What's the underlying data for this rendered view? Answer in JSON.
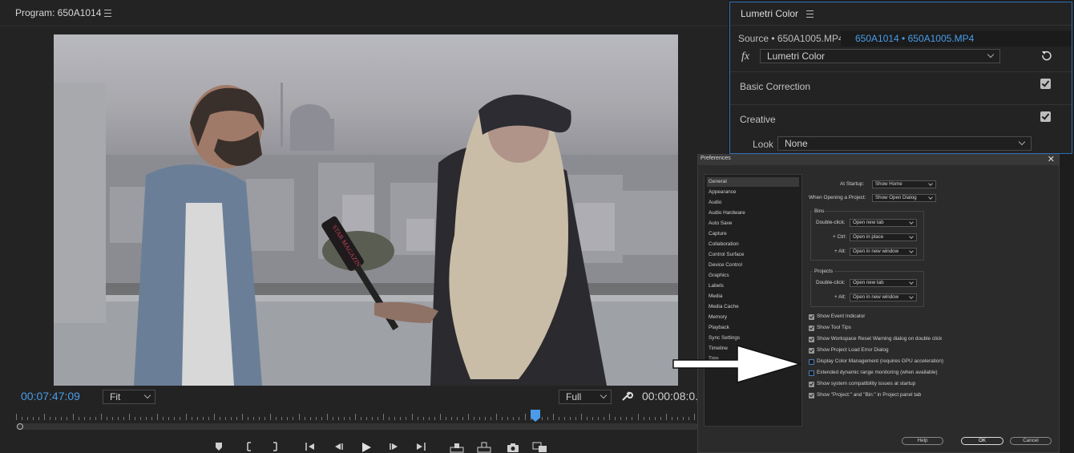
{
  "program": {
    "title": "Program: 650A1014",
    "timecode": "00:07:47:09",
    "fit_value": "Fit",
    "quality_value": "Full",
    "duration": "00:00:08:0."
  },
  "lumetri": {
    "title": "Lumetri Color",
    "source": "Source • 650A1005.MP4",
    "clip": "650A1014 • 650A1005.MP4",
    "fx_label": "fx",
    "effect": "Lumetri Color",
    "basic_correction": "Basic Correction",
    "creative": "Creative",
    "look_label": "Look",
    "look_value": "None",
    "accent": "#4a9ce8"
  },
  "video": {
    "microphone_text": "STAR MAGAZIN"
  },
  "prefs": {
    "title": "Preferences",
    "categories": [
      "General",
      "Appearance",
      "Audio",
      "Audio Hardware",
      "Auto Save",
      "Capture",
      "Collaboration",
      "Control Surface",
      "Device Control",
      "Graphics",
      "Labels",
      "Media",
      "Media Cache",
      "Memory",
      "Playback",
      "Sync Settings",
      "Timeline",
      "Trim"
    ],
    "at_startup_label": "At Startup:",
    "at_startup_value": "Show Home",
    "opening_label": "When Opening a Project:",
    "opening_value": "Show Open Dialog",
    "bins": {
      "title": "Bins",
      "dbl_label": "Double-click:",
      "dbl_value": "Open new tab",
      "ctrl_label": "+ Ctrl:",
      "ctrl_value": "Open in place",
      "alt_label": "+ Alt:",
      "alt_value": "Open in new window"
    },
    "projects": {
      "title": "Projects",
      "dbl_label": "Double-click:",
      "dbl_value": "Open new tab",
      "alt_label": "+ Alt:",
      "alt_value": "Open in new window"
    },
    "checkboxes": [
      {
        "label": "Show Event Indicator",
        "checked": true
      },
      {
        "label": "Show Tool Tips",
        "checked": true
      },
      {
        "label": "Show Workspace Reset Warning dialog on double click",
        "checked": true
      },
      {
        "label": "Show Project Load Error Dialog",
        "checked": true
      },
      {
        "label": "Display Color Management (requires GPU acceleration)",
        "checked": false
      },
      {
        "label": "Extended dynamic range monitoring (when available)",
        "checked": false
      },
      {
        "label": "Show system compatibility issues at startup",
        "checked": true
      },
      {
        "label": "Show \"Project:\" and \"Bin:\" in Project panel tab",
        "checked": true
      }
    ],
    "help_label": "Help",
    "ok_label": "OK",
    "cancel_label": "Cancel"
  }
}
